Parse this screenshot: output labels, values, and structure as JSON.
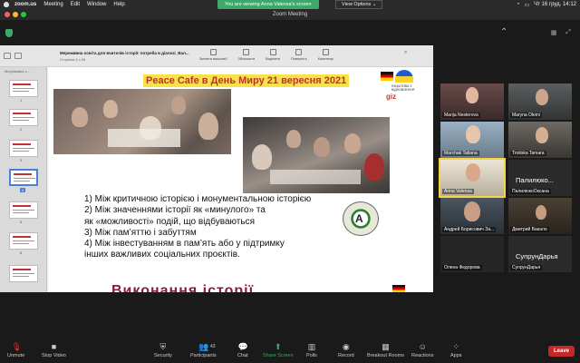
{
  "menubar": {
    "items": [
      "zoom.us",
      "Meeting",
      "Edit",
      "Window",
      "Help"
    ],
    "datetime": "Чт 16 груд. 14:12",
    "share_banner": "You are viewing Anna Valensa's screen",
    "view_options": "View Options ⌄"
  },
  "window": {
    "title": "Zoom Meeting"
  },
  "pdf": {
    "title": "Мереживна освіта для вчителів історії: потреба в діалозі_Вал...",
    "subtitle": "Сторінка 4 з 28",
    "tools": [
      "Змінити масштаб",
      "Збільшити",
      "Виділити",
      "Поверніть",
      "Коментар"
    ],
    "thumb_label": "Мереживна о..."
  },
  "slide": {
    "title": "Peace Cafe в День Миру 21 вересня 2021",
    "logo_text": "ІНІЦІАТИВА З ВІДНОВЛЕННЯ",
    "giz": "giz",
    "list": [
      "1)  Між критичною історією і монументальною історією",
      "2) Між значеннями історії як «минулого» та",
      "      як   «можливості» подій, що відбуваються",
      "3) Між пам’яттю і забуттям",
      "4) Між інвестуванням в пам’ять або у підтримку",
      "                    інших  важливих соціальних проєктів."
    ],
    "bottom_title": "Виконання історії"
  },
  "participants": [
    {
      "name": "Marija Nesterova"
    },
    {
      "name": "Maryna Oleini"
    },
    {
      "name": "Marchak Tatiana"
    },
    {
      "name": "Troitska Tamara"
    },
    {
      "name": "Anna Valensa"
    },
    {
      "name": "ПалилюкоОксана",
      "big": "Палилюко..."
    },
    {
      "name": "Андрей Борисович За..."
    },
    {
      "name": "Дмитрий Вакало"
    },
    {
      "name": "Олена Федорова"
    },
    {
      "name": "СупрунДарья",
      "big": "СупрунДарья"
    }
  ],
  "toolbar": {
    "unmute": "Unmute",
    "stop_video": "Stop Video",
    "security": "Security",
    "participants": "Participants",
    "participants_count": "43",
    "chat": "Chat",
    "share_screen": "Share Screen",
    "polls": "Polls",
    "record": "Record",
    "breakout": "Breakout Rooms",
    "reactions": "Reactions",
    "apps": "Apps",
    "leave": "Leave"
  },
  "colors": {
    "accent": "#3ea86b",
    "leave": "#c62828",
    "title_bg": "#f7e24a",
    "title_fg": "#c03030"
  }
}
